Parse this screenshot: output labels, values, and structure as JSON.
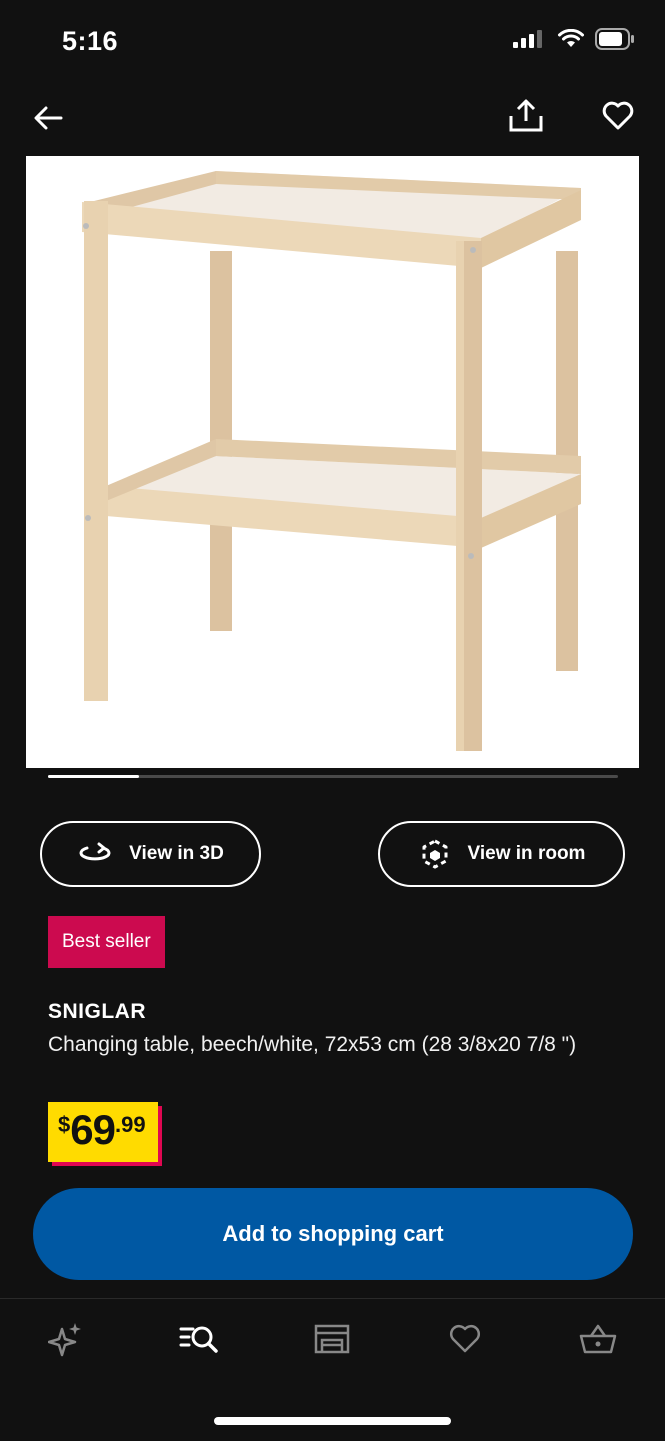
{
  "status_bar": {
    "time": "5:16"
  },
  "top_nav": {
    "back_icon": "arrow-left-icon",
    "share_icon": "share-icon",
    "favorite_icon": "heart-icon"
  },
  "carousel": {
    "progress": 0.16
  },
  "actions": {
    "view_3d_label": "View in 3D",
    "view_room_label": "View in room"
  },
  "badge": {
    "label": "Best seller",
    "color": "#cc0a4f"
  },
  "product": {
    "name": "SNIGLAR",
    "description": "Changing table, beech/white, 72x53 cm (28 3/8x20 7/8 \")",
    "price": {
      "currency": "$",
      "integer": "69",
      "decimal": ".99"
    }
  },
  "cart_button": {
    "label": "Add to shopping cart",
    "color": "#0058a3"
  },
  "tab_bar": {
    "items": [
      {
        "icon": "sparkle-icon"
      },
      {
        "icon": "search-list-icon"
      },
      {
        "icon": "store-icon"
      },
      {
        "icon": "heart-icon"
      },
      {
        "icon": "basket-icon"
      }
    ]
  },
  "colors": {
    "price_bg": "#ffdb00",
    "price_shadow": "#e00751",
    "background": "#111111"
  }
}
